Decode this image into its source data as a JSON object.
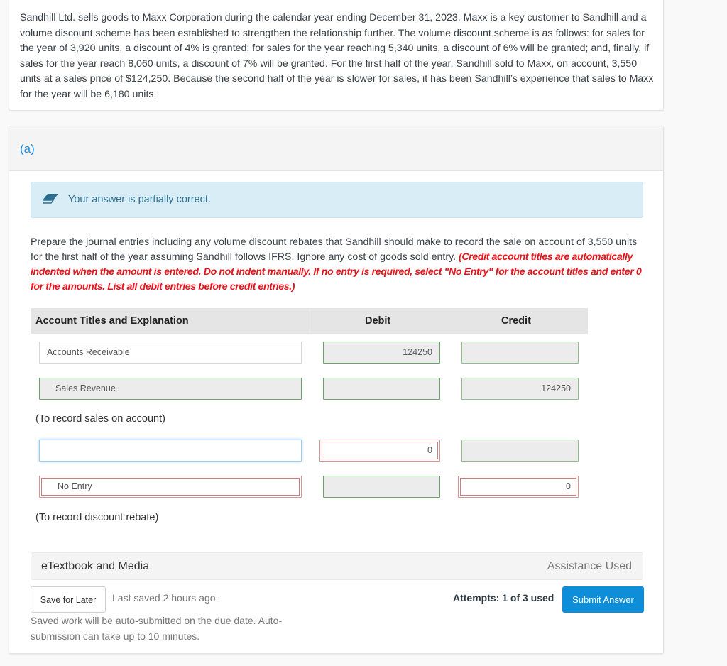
{
  "problem": {
    "text": "Sandhill Ltd. sells goods to Maxx Corporation during the calendar year ending December 31, 2023. Maxx is a key customer to Sandhill and a volume discount scheme has been established to strengthen the relationship further. The volume discount scheme is as follows: for sales for the year of 3,920 units, a discount of 4% is granted; for sales for the year reaching 5,340 units, a discount of 6% will be granted; and, finally, if sales for the year reach 8,060 units, a discount of 7% will be granted. For the first half of the year, Sandhill sold to Maxx, on account, 3,550 units at a sales price of $124,250. Because the second half of the year is slower for sales, it has been Sandhill’s experience that sales to Maxx for the year will be 6,180 units."
  },
  "part": {
    "label": "(a)",
    "status": {
      "icon": "eraser-icon",
      "text": "Your answer is partially correct."
    },
    "instructions": {
      "text": "Prepare the journal entries including any volume discount rebates that Sandhill should make to record the sale on account of 3,550 units for the first half of the year assuming Sandhill follows IFRS. Ignore any cost of goods sold entry. ",
      "note": "(Credit account titles are automatically indented when the amount is entered. Do not indent manually. If no entry is required, select \"No Entry\" for the account titles and enter 0 for the amounts. List all debit entries before credit entries.)"
    },
    "table": {
      "headers": {
        "account": "Account Titles and Explanation",
        "debit": "Debit",
        "credit": "Credit"
      },
      "entries": [
        {
          "rows": [
            {
              "account": "Accounts Receivable",
              "debit": "124250",
              "credit": "",
              "account_state": "neutral",
              "debit_state": "correct",
              "credit_state": "correct"
            },
            {
              "account": "Sales Revenue",
              "debit": "",
              "credit": "124250",
              "account_state": "correct",
              "debit_state": "correct",
              "credit_state": "correct"
            }
          ],
          "caption": "(To record sales on account)"
        },
        {
          "rows": [
            {
              "account": "",
              "debit": "0",
              "credit": "",
              "account_state": "focused",
              "debit_state": "incorrect",
              "credit_state": "correct"
            },
            {
              "account": "No Entry",
              "debit": "",
              "credit": "0",
              "account_state": "incorrect",
              "debit_state": "correct",
              "credit_state": "incorrect"
            }
          ],
          "caption": "(To record discount rebate)"
        }
      ]
    },
    "media_bar": {
      "label": "eTextbook and Media",
      "assistance": "Assistance Used"
    },
    "footer": {
      "save_label": "Save for Later",
      "last_saved": "Last saved 2 hours ago.",
      "auto_note": "Saved work will be auto-submitted on the due date. Auto-submission can take up to 10 minutes.",
      "attempts": "Attempts: 1 of 3 used",
      "submit_label": "Submit Answer"
    }
  },
  "colors": {
    "accent": "#0e8ed9",
    "part_label": "#1b8ee0",
    "note_red": "#e8141b",
    "status_bg": "#d9edf7",
    "status_text": "#31708f",
    "correct_border": "#6aa36a",
    "incorrect_border": "#cc7d7d"
  }
}
